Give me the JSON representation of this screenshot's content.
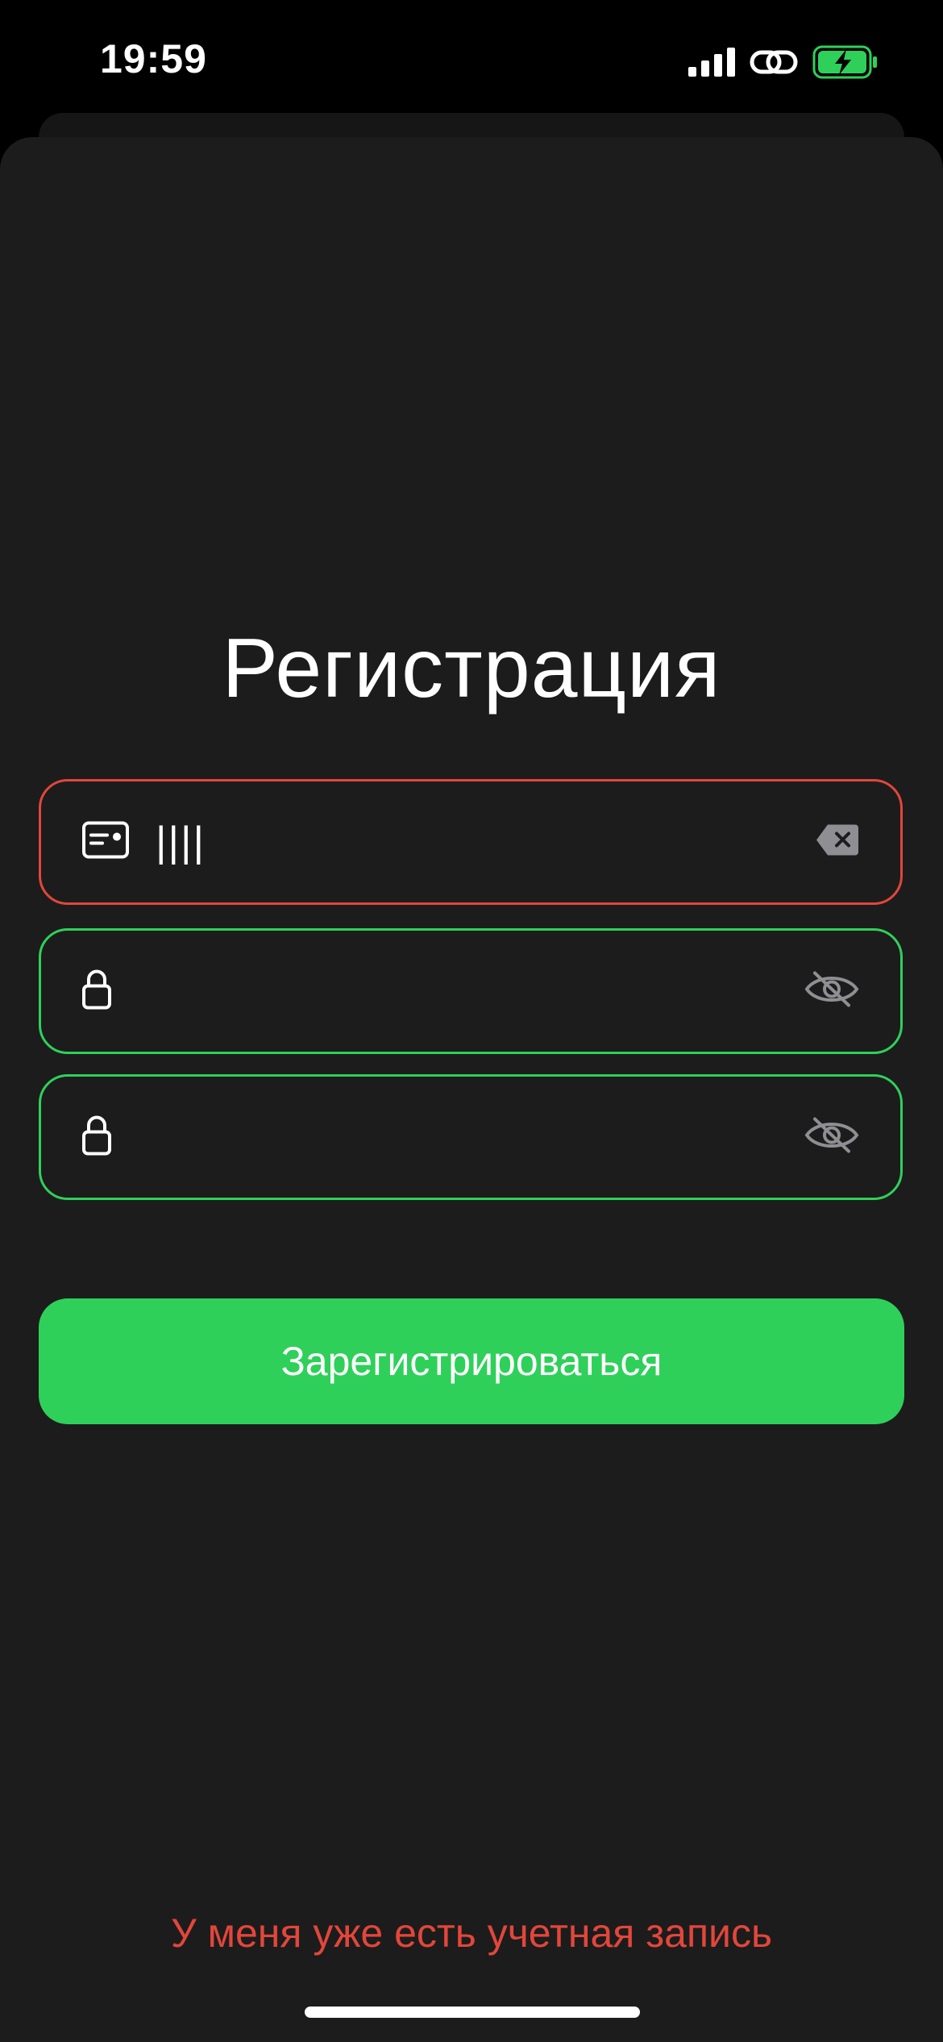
{
  "status_bar": {
    "time": "19:59",
    "icons": [
      "signal-icon",
      "link-icon",
      "battery-charging-icon"
    ],
    "battery_color": "#2fd05a"
  },
  "page": {
    "title": "Регистрация"
  },
  "form": {
    "id_field": {
      "value": "||||",
      "placeholder": "",
      "state": "error",
      "border_color": "#e2463b",
      "lead_icon": "id-card-icon",
      "trail_icon": "clear-backspace-icon"
    },
    "password_field": {
      "value": "",
      "placeholder": "",
      "state": "valid",
      "border_color": "#2fd05a",
      "lead_icon": "lock-icon",
      "trail_icon": "eye-slash-icon"
    },
    "confirm_password_field": {
      "value": "",
      "placeholder": "",
      "state": "valid",
      "border_color": "#2fd05a",
      "lead_icon": "lock-icon",
      "trail_icon": "eye-slash-icon"
    },
    "submit_label": "Зарегистрироваться",
    "submit_color": "#2fd05a"
  },
  "footer": {
    "login_link": "У меня уже есть учетная запись",
    "link_color": "#e2463b"
  }
}
